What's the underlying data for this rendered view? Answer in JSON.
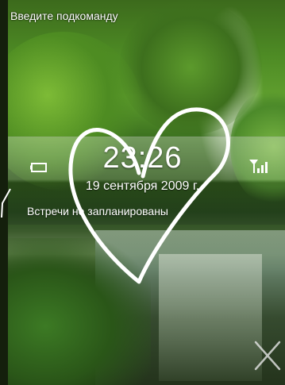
{
  "input": {
    "placeholder": "Введите подкоманду"
  },
  "today": {
    "time": "23:26",
    "date": "19 сентября 2009 г.",
    "appointments": "Встречи не запланированы"
  },
  "icons": {
    "battery": "battery-icon",
    "signal": "signal-strength-icon",
    "close": "close-icon",
    "gesture": "heart-gesture-stroke"
  },
  "colors": {
    "text": "#ffffff",
    "gesture_stroke": "#ffffff"
  }
}
